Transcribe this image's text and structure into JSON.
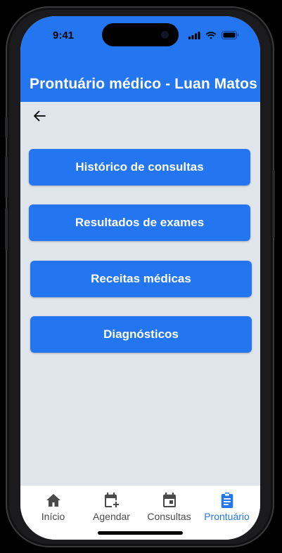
{
  "status_bar": {
    "time": "9:41"
  },
  "header": {
    "title": "Prontuário médico - Luan Matos"
  },
  "back_icon": "arrow-left-icon",
  "menu": [
    {
      "label": "Histórico de consultas"
    },
    {
      "label": "Resultados de exames"
    },
    {
      "label": "Receitas médicas"
    },
    {
      "label": "Diagnósticos"
    }
  ],
  "tabs": [
    {
      "label": "Início",
      "icon": "home-icon",
      "active": false
    },
    {
      "label": "Agendar",
      "icon": "calendar-plus-icon",
      "active": false
    },
    {
      "label": "Consultas",
      "icon": "calendar-icon",
      "active": false
    },
    {
      "label": "Prontuário",
      "icon": "clipboard-icon",
      "active": true
    }
  ],
  "colors": {
    "primary": "#2476f0",
    "background": "#e0e4eb",
    "tab_inactive": "#4a4a4a"
  }
}
